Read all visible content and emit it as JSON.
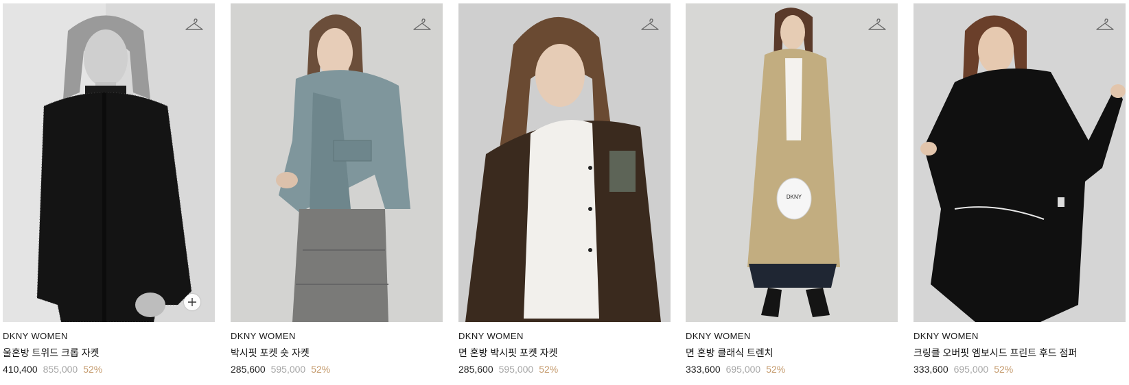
{
  "icons": {
    "wishlist": "hanger-icon",
    "quick_add": "plus-icon"
  },
  "colors": {
    "discount": "#c49a6c",
    "original_price": "#a6a6a6",
    "text": "#1a1a1a"
  },
  "products": [
    {
      "brand": "DKNY WOMEN",
      "name": "울혼방 트위드 크롭 자켓",
      "price": "410,400",
      "original_price": "855,000",
      "discount": "52%"
    },
    {
      "brand": "DKNY WOMEN",
      "name": "박시핏 포켓 숏 자켓",
      "price": "285,600",
      "original_price": "595,000",
      "discount": "52%"
    },
    {
      "brand": "DKNY WOMEN",
      "name": "면 혼방 박시핏 포켓 자켓",
      "price": "285,600",
      "original_price": "595,000",
      "discount": "52%"
    },
    {
      "brand": "DKNY WOMEN",
      "name": "면 혼방 클래식 트렌치",
      "price": "333,600",
      "original_price": "695,000",
      "discount": "52%"
    },
    {
      "brand": "DKNY WOMEN",
      "name": "크링클 오버핏 엠보시드 프린트 후드 점퍼",
      "price": "333,600",
      "original_price": "695,000",
      "discount": "52%"
    }
  ]
}
